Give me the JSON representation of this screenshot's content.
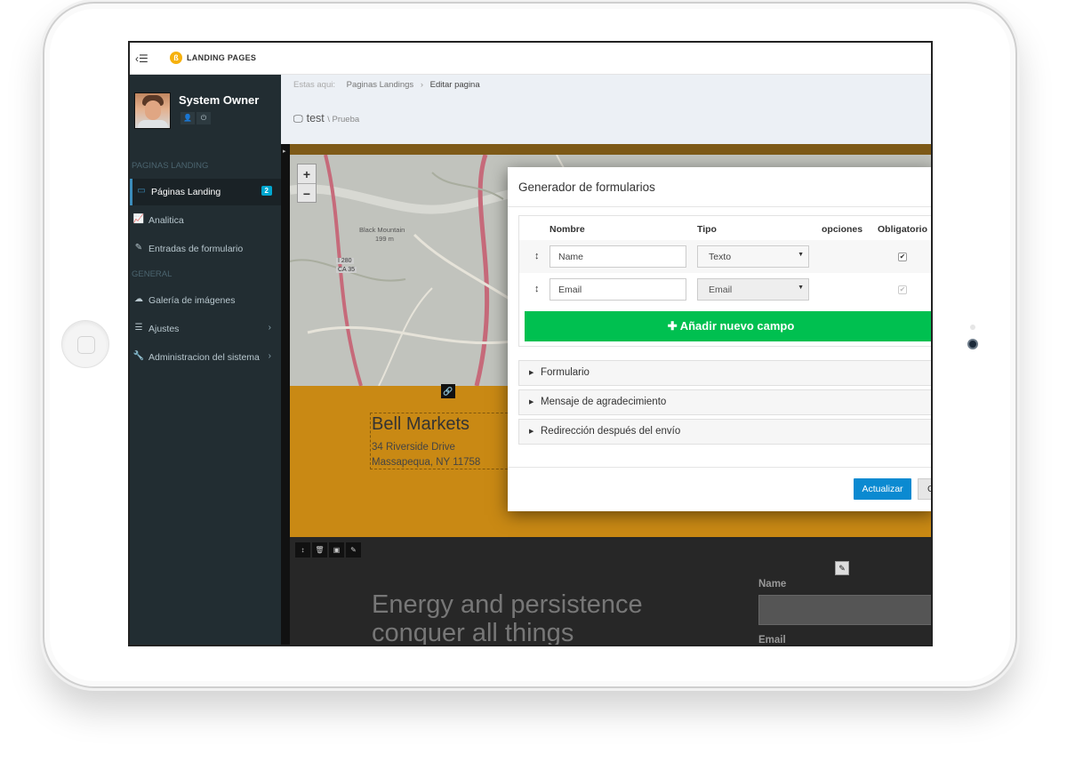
{
  "app": {
    "title": "LANDING PAGES",
    "logo_glyph": "ß",
    "menu_toggle": "‹☰"
  },
  "user": {
    "name": "System Owner",
    "icon_user": "👤",
    "icon_power": "⏻"
  },
  "sidebar": {
    "section1": "PAGINAS LANDING",
    "section2": "GENERAL",
    "items": [
      {
        "label": "Páginas Landing",
        "badge": "2",
        "icon": "laptop-icon"
      },
      {
        "label": "Analitica",
        "icon": "line-chart-icon"
      },
      {
        "label": "Entradas de formulario",
        "icon": "edit-icon"
      },
      {
        "label": "Galería de imágenes",
        "icon": "cloud-icon"
      },
      {
        "label": "Ajustes",
        "icon": "sliders-icon"
      },
      {
        "label": "Administracion del sistema",
        "icon": "wrench-icon"
      }
    ]
  },
  "breadcrumb": {
    "here": "Estas aqui:",
    "level1": "Paginas Landings",
    "level2": "Editar pagina"
  },
  "page": {
    "title": "test",
    "subtitle": "\\ Prueba"
  },
  "editor": {
    "map": {
      "zoom_in": "+",
      "zoom_out": "−",
      "labels": [
        "Black Mountain",
        "199 m",
        "I 280",
        "CA 35"
      ]
    },
    "bell": {
      "title": "Bell Markets",
      "address1": "34 Riverside Drive",
      "address2": "Massapequa, NY 11758"
    },
    "quote_line1": "Energy and persistence",
    "quote_line2": "conquer all things",
    "form_name_label": "Name",
    "form_email_label": "Email"
  },
  "modal": {
    "title": "Generador de formularios",
    "columns": {
      "name": "Nombre",
      "type": "Tipo",
      "options": "opciones",
      "required": "Obligatorio"
    },
    "fields": [
      {
        "name": "Name",
        "type": "Texto",
        "required": true,
        "disabled": false
      },
      {
        "name": "Email",
        "type": "Email",
        "required": true,
        "disabled": true
      }
    ],
    "add_button": "✚ Añadir nuevo campo",
    "sections": [
      "Formulario",
      "Mensaje de agradecimiento",
      "Redirección después del envío"
    ],
    "update_button": "Actualizar",
    "cancel_button": "C"
  },
  "colors": {
    "sidebar_bg": "#222d32",
    "accent": "#3c8dbc",
    "add_button": "#00c050",
    "update_button": "#0b8ad1",
    "section_orange": "#c98914"
  }
}
